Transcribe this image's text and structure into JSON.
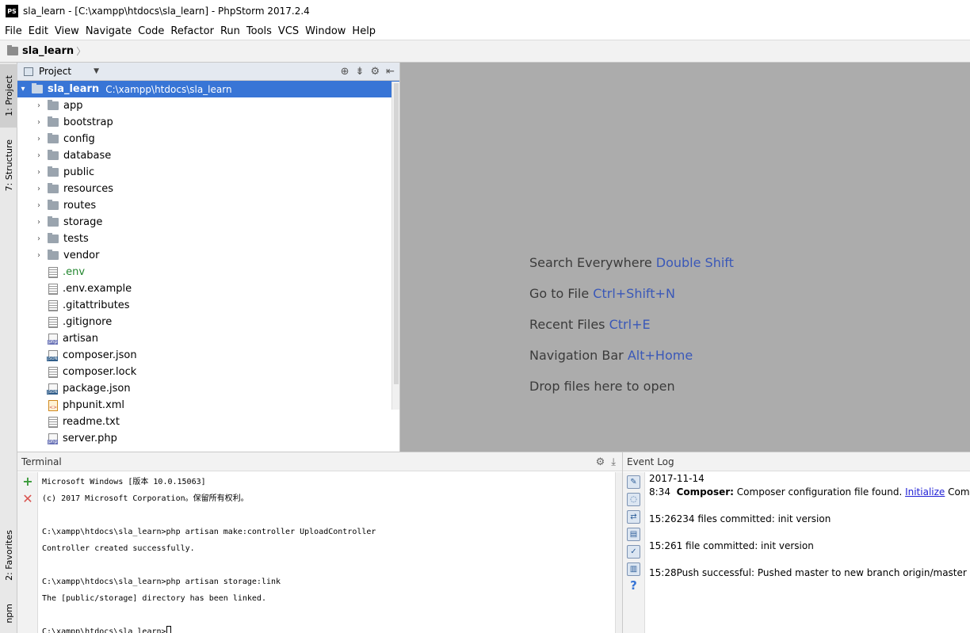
{
  "window": {
    "title": "sla_learn - [C:\\xampp\\htdocs\\sla_learn] - PhpStorm 2017.2.4",
    "logo": "PS"
  },
  "menu": [
    {
      "label": "File"
    },
    {
      "label": "Edit"
    },
    {
      "label": "View"
    },
    {
      "label": "Navigate"
    },
    {
      "label": "Code"
    },
    {
      "label": "Refactor"
    },
    {
      "label": "Run"
    },
    {
      "label": "Tools"
    },
    {
      "label": "VCS"
    },
    {
      "label": "Window"
    },
    {
      "label": "Help"
    }
  ],
  "navbar": {
    "crumb": "sla_learn",
    "chevron": "〉"
  },
  "left_strip": {
    "project_tab": "1: Project",
    "structure_tab": "7: Structure",
    "favorites_tab": "2: Favorites",
    "npm_tab": "npm"
  },
  "project": {
    "header_title": "Project",
    "root": {
      "name": "sla_learn",
      "path": "C:\\xampp\\htdocs\\sla_learn"
    },
    "folders": [
      "app",
      "bootstrap",
      "config",
      "database",
      "public",
      "resources",
      "routes",
      "storage",
      "tests",
      "vendor"
    ],
    "files": [
      {
        "name": ".env",
        "icon": "txt",
        "green": true
      },
      {
        "name": ".env.example",
        "icon": "txt"
      },
      {
        "name": ".gitattributes",
        "icon": "txt"
      },
      {
        "name": ".gitignore",
        "icon": "txt"
      },
      {
        "name": "artisan",
        "icon": "php"
      },
      {
        "name": "composer.json",
        "icon": "json"
      },
      {
        "name": "composer.lock",
        "icon": "txt"
      },
      {
        "name": "package.json",
        "icon": "json"
      },
      {
        "name": "phpunit.xml",
        "icon": "xml"
      },
      {
        "name": "readme.txt",
        "icon": "txt"
      },
      {
        "name": "server.php",
        "icon": "php"
      }
    ]
  },
  "editor_hints": [
    {
      "text": "Search Everywhere",
      "shortcut": "Double Shift"
    },
    {
      "text": "Go to File",
      "shortcut": "Ctrl+Shift+N"
    },
    {
      "text": "Recent Files",
      "shortcut": "Ctrl+E"
    },
    {
      "text": "Navigation Bar",
      "shortcut": "Alt+Home"
    },
    {
      "text": "Drop files here to open",
      "shortcut": ""
    }
  ],
  "terminal": {
    "title": "Terminal",
    "lines": [
      "Microsoft Windows [版本 10.0.15063]",
      "(c) 2017 Microsoft Corporation。保留所有权利。",
      "",
      "C:\\xampp\\htdocs\\sla_learn>php artisan make:controller UploadController",
      "Controller created successfully.",
      "",
      "C:\\xampp\\htdocs\\sla_learn>php artisan storage:link",
      "The [public/storage] directory has been linked.",
      "",
      "C:\\xampp\\htdocs\\sla_learn>"
    ]
  },
  "event_log": {
    "title": "Event Log",
    "date": "2017-11-14",
    "entries": [
      {
        "time": "8:34",
        "bold": "Composer:",
        "text": " Composer configuration file found. ",
        "link": "Initialize",
        "tail": " Compos"
      },
      {
        "time": "15:26",
        "text": "234 files committed: init version"
      },
      {
        "time": "15:26",
        "text": "1 file committed: init version"
      },
      {
        "time": "15:28",
        "text": "Push successful: Pushed master to new branch origin/master"
      }
    ]
  }
}
